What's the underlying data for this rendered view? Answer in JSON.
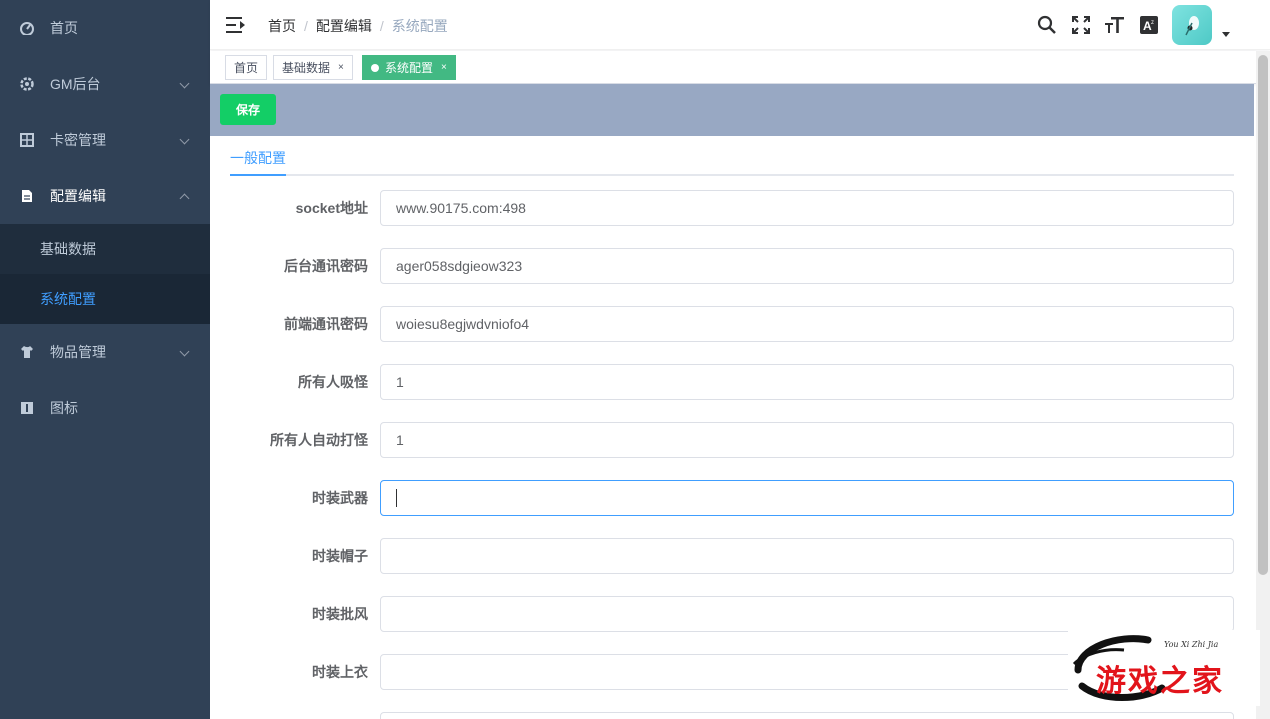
{
  "sidebar": {
    "items": [
      {
        "label": "首页",
        "icon": "dashboard-icon"
      },
      {
        "label": "GM后台",
        "icon": "gear-icon"
      },
      {
        "label": "卡密管理",
        "icon": "grid-icon"
      },
      {
        "label": "配置编辑",
        "icon": "document-icon"
      },
      {
        "label": "物品管理",
        "icon": "shirt-icon"
      },
      {
        "label": "图标",
        "icon": "icon-icon"
      }
    ],
    "submenu": [
      {
        "label": "基础数据"
      },
      {
        "label": "系统配置"
      }
    ],
    "active_color": "#409eff",
    "background": "#304156"
  },
  "header": {
    "breadcrumb": [
      "首页",
      "配置编辑",
      "系统配置"
    ],
    "separator": "/"
  },
  "tags": [
    {
      "label": "首页"
    },
    {
      "label": "基础数据",
      "close": "×"
    },
    {
      "label": "系统配置",
      "close": "×"
    }
  ],
  "toolbar": {
    "save_label": "保存"
  },
  "tabs": [
    {
      "label": "一般配置"
    }
  ],
  "form": [
    {
      "label": "socket地址",
      "value": "www.90175.com:498"
    },
    {
      "label": "后台通讯密码",
      "value": "ager058sdgieow323"
    },
    {
      "label": "前端通讯密码",
      "value": "woiesu8egjwdvniofo4"
    },
    {
      "label": "所有人吸怪",
      "value": "1"
    },
    {
      "label": "所有人自动打怪",
      "value": "1"
    },
    {
      "label": "时装武器",
      "value": ""
    },
    {
      "label": "时装帽子",
      "value": ""
    },
    {
      "label": "时装批风",
      "value": ""
    },
    {
      "label": "时装上衣",
      "value": ""
    }
  ],
  "logo": {
    "text": "游戏之家",
    "sub": "You Xi Zhi Jia"
  }
}
